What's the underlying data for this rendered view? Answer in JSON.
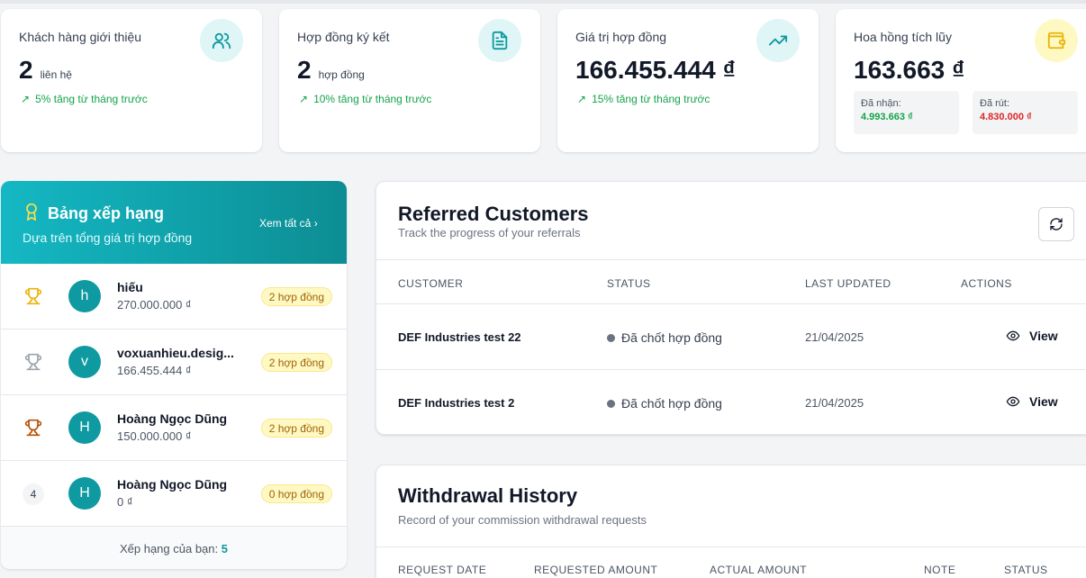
{
  "stats": [
    {
      "label": "Khách hàng giới thiệu",
      "value": "2",
      "unit": "liên hệ",
      "trend": "5% tăng từ tháng trước",
      "icon": "users-icon",
      "icon_bg": "#dff5f6",
      "icon_color": "#0e9aa0"
    },
    {
      "label": "Hợp đồng ký kết",
      "value": "2",
      "unit": "hợp đồng",
      "trend": "10% tăng từ tháng trước",
      "icon": "document-icon",
      "icon_bg": "#dff5f6",
      "icon_color": "#0e9aa0"
    },
    {
      "label": "Giá trị hợp đồng",
      "value": "166.455.444 ₫",
      "trend": "15% tăng từ tháng trước",
      "icon": "trending-up-icon",
      "icon_bg": "#dff5f6",
      "icon_color": "#0e9aa0"
    },
    {
      "label": "Hoa hồng tích lũy",
      "value": "163.663 ₫",
      "icon": "wallet-icon",
      "icon_bg": "#fef9c3",
      "icon_color": "#eab308",
      "received_label": "Đã nhận:",
      "received_value": "4.993.663 ₫",
      "withdrawn_label": "Đã rút:",
      "withdrawn_value": "4.830.000 ₫"
    }
  ],
  "leaderboard": {
    "title": "Bảng xếp hạng",
    "subtitle": "Dựa trên tổng giá trị hợp đồng",
    "see_all": "Xem tất cả ›",
    "rows": [
      {
        "rank_icon": "gold-trophy-icon",
        "avatar": "h",
        "name": "hiếu",
        "amount": "270.000.000 ₫",
        "badge": "2 hợp đồng"
      },
      {
        "rank_icon": "silver-trophy-icon",
        "avatar": "v",
        "name": "voxuanhieu.desig...",
        "amount": "166.455.444 ₫",
        "badge": "2 hợp đồng"
      },
      {
        "rank_icon": "bronze-trophy-icon",
        "avatar": "H",
        "name": "Hoàng Ngọc Dũng",
        "amount": "150.000.000 ₫",
        "badge": "2 hợp đồng"
      },
      {
        "rank_no": "4",
        "avatar": "H",
        "name": "Hoàng Ngọc Dũng",
        "amount": "0 ₫",
        "badge": "0 hợp đồng"
      }
    ],
    "your_rank_label": "Xếp hạng của bạn:",
    "your_rank": "5"
  },
  "referred": {
    "title": "Referred Customers",
    "subtitle": "Track the progress of your referrals",
    "columns": [
      "CUSTOMER",
      "STATUS",
      "LAST UPDATED",
      "ACTIONS"
    ],
    "rows": [
      {
        "customer": "DEF Industries test 22",
        "status": "Đã chốt hợp đồng",
        "updated": "21/04/2025",
        "action": "View"
      },
      {
        "customer": "DEF Industries test 2",
        "status": "Đã chốt hợp đồng",
        "updated": "21/04/2025",
        "action": "View"
      }
    ]
  },
  "withdrawal": {
    "title": "Withdrawal History",
    "subtitle": "Record of your commission withdrawal requests",
    "columns": [
      "REQUEST DATE",
      "REQUESTED AMOUNT",
      "ACTUAL AMOUNT",
      "NOTE",
      "STATUS"
    ]
  },
  "colors": {
    "accent": "#0e9aa0",
    "positive": "#16a34a",
    "negative": "#dc2626",
    "badge_bg": "#fef9c3"
  }
}
